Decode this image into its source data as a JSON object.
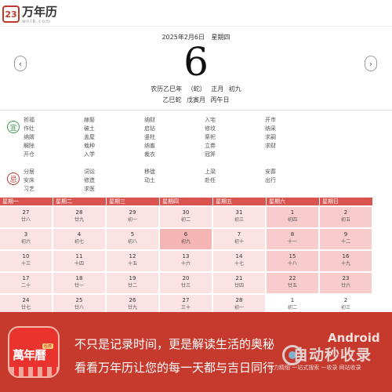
{
  "header": {
    "logo_glyph": "23",
    "logo_title": "万年历",
    "logo_sub": "wnl8.com"
  },
  "date": {
    "gregorian": "2025年2月6日",
    "weekday": "星期四",
    "day": "6",
    "lunar_label": "农历乙巳年",
    "zodiac": "（蛇）",
    "lunar_month": "正月",
    "lunar_day": "初九",
    "gz_year": "乙巳蛇",
    "gz_month": "戊寅月",
    "gz_day": "丙午日"
  },
  "nav": {
    "prev": "‹",
    "next": "›"
  },
  "yi": {
    "label": "宜",
    "items": [
      "祈福",
      "嫁娶",
      "纳财",
      "入宅",
      "开市",
      "作灶",
      "破土",
      "启钻",
      "修坟",
      "纳采",
      "纳婿",
      "盖屋",
      "竖柱",
      "祭祀",
      "求嗣",
      "解除",
      "栽种",
      "纳畜",
      "立券",
      "求财",
      "开仓",
      "入学",
      "裁衣",
      "冠笄",
      ""
    ]
  },
  "ji": {
    "label": "忌",
    "items": [
      "分居",
      "词讼",
      "移徙",
      "上梁",
      "安葬",
      "安床",
      "修造",
      "动土",
      "赴任",
      "出行",
      "习艺",
      "求医",
      "",
      "",
      ""
    ]
  },
  "calendar": {
    "headers": [
      "星期一",
      "星期二",
      "星期三",
      "星期四",
      "星期五",
      "星期六",
      "星期日"
    ],
    "rows": [
      [
        [
          "27",
          "廿八"
        ],
        [
          "28",
          "廿九"
        ],
        [
          "29",
          "初一"
        ],
        [
          "30",
          "初二"
        ],
        [
          "31",
          "初三"
        ],
        [
          "1",
          "初四"
        ],
        [
          "2",
          "初五"
        ]
      ],
      [
        [
          "3",
          "初六"
        ],
        [
          "4",
          "初七"
        ],
        [
          "5",
          "初八"
        ],
        [
          "6",
          "初九"
        ],
        [
          "7",
          "初十"
        ],
        [
          "8",
          "十一"
        ],
        [
          "9",
          "十二"
        ]
      ],
      [
        [
          "10",
          "十三"
        ],
        [
          "11",
          "十四"
        ],
        [
          "12",
          "十五"
        ],
        [
          "13",
          "十六"
        ],
        [
          "14",
          "十七"
        ],
        [
          "15",
          "十八"
        ],
        [
          "16",
          "十九"
        ]
      ],
      [
        [
          "17",
          "二十"
        ],
        [
          "18",
          "廿一"
        ],
        [
          "19",
          "廿二"
        ],
        [
          "20",
          "廿三"
        ],
        [
          "21",
          "廿四"
        ],
        [
          "22",
          "廿五"
        ],
        [
          "23",
          "廿六"
        ]
      ],
      [
        [
          "24",
          "廿七"
        ],
        [
          "25",
          "廿八"
        ],
        [
          "26",
          "廿九"
        ],
        [
          "27",
          "三十"
        ],
        [
          "28",
          "初一"
        ],
        [
          "1",
          "初二"
        ],
        [
          "2",
          "初三"
        ]
      ]
    ]
  },
  "banner": {
    "icon_text": "萬年曆",
    "icon_tag": "经典",
    "line1": "不只是记录时间，更是解读生活的奥秘",
    "line2": "看看万年历让您的每一天都与吉日同行",
    "watermark_top": "Android",
    "watermark_main": "自动秒收录",
    "watermark_sub": "致力精细 一站式搜索 一收录 网站收录"
  }
}
